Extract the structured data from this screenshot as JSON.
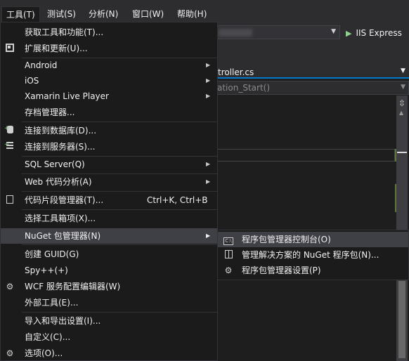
{
  "menubar": {
    "items": [
      "工具(T)",
      "测试(S)",
      "分析(N)",
      "窗口(W)",
      "帮助(H)"
    ]
  },
  "toolbar": {
    "run_label": "IIS Express"
  },
  "editor": {
    "tab_title": "troller.cs",
    "member_nav": "ation_Start()"
  },
  "tools_menu": {
    "items": [
      {
        "label": "获取工具和功能(T)..."
      },
      {
        "label": "扩展和更新(U)..."
      },
      {
        "label": "Android"
      },
      {
        "label": "iOS"
      },
      {
        "label": "Xamarin Live Player"
      },
      {
        "label": "存档管理器..."
      },
      {
        "label": "连接到数据库(D)..."
      },
      {
        "label": "连接到服务器(S)..."
      },
      {
        "label": "SQL Server(Q)"
      },
      {
        "label": "Web 代码分析(A)"
      },
      {
        "label": "代码片段管理器(T)...",
        "shortcut": "Ctrl+K, Ctrl+B"
      },
      {
        "label": "选择工具箱项(X)..."
      },
      {
        "label": "NuGet 包管理器(N)"
      },
      {
        "label": "创建 GUID(G)"
      },
      {
        "label": "Spy++(+)"
      },
      {
        "label": "WCF 服务配置编辑器(W)"
      },
      {
        "label": "外部工具(E)..."
      },
      {
        "label": "导入和导出设置(I)..."
      },
      {
        "label": "自定义(C)..."
      },
      {
        "label": "选项(O)..."
      }
    ]
  },
  "nuget_submenu": {
    "items": [
      {
        "label": "程序包管理器控制台(O)",
        "icon": "console-icon"
      },
      {
        "label": "管理解决方案的 NuGet 程序包(N)...",
        "icon": "package-icon"
      },
      {
        "label": "程序包管理器设置(P)",
        "icon": "gear-icon"
      }
    ]
  },
  "colors": {
    "menu_bg": "#1b1b1c",
    "hover_bg": "#3f3f46",
    "accent": "#007acc",
    "run_green": "#8dd28a"
  }
}
